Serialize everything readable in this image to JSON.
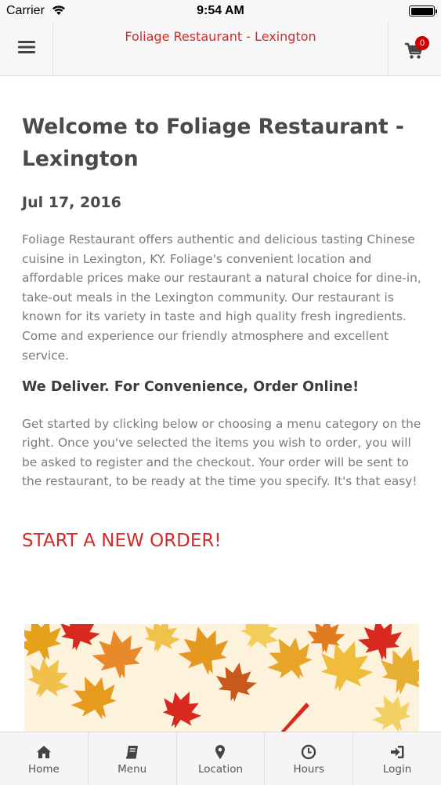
{
  "status_bar": {
    "carrier": "Carrier",
    "time": "9:54 AM"
  },
  "header": {
    "title": "Foliage Restaurant - Lexington",
    "cart_count": "0",
    "menu_icon": "hamburger-icon",
    "cart_icon": "cart-icon"
  },
  "main": {
    "welcome_title": "Welcome to Foliage Restaurant - Lexington",
    "date": "Jul 17, 2016",
    "intro": "Foliage Restaurant offers authentic and delicious tasting Chinese cuisine in Lexington, KY. Foliage's convenient location and affordable prices make our restaurant a natural choice for dine-in, take-out meals in the Lexington community. Our restaurant is known for its variety in taste and high quality fresh ingredients. Come and experience our friendly atmosphere and excellent service.",
    "deliver_heading": "We Deliver. For Convenience, Order Online!",
    "instructions": "Get started by clicking below or choosing a menu category on the right. Once you've selected the items you wish to order, you will be asked to register and the checkout. Your order will be sent to the restaurant, to be ready at the time you specify. It's that easy!",
    "start_order_label": "START A NEW ORDER!"
  },
  "tabs": [
    {
      "label": "Home",
      "icon": "home-icon"
    },
    {
      "label": "Menu",
      "icon": "book-icon"
    },
    {
      "label": "Location",
      "icon": "map-pin-icon"
    },
    {
      "label": "Hours",
      "icon": "clock-icon"
    },
    {
      "label": "Login",
      "icon": "login-icon"
    }
  ],
  "colors": {
    "accent": "#d42a2a",
    "badge": "#cc0000",
    "header_bg": "#f7f7f7",
    "heading_text": "#4a4a4a",
    "body_text": "#7a7a7a"
  }
}
